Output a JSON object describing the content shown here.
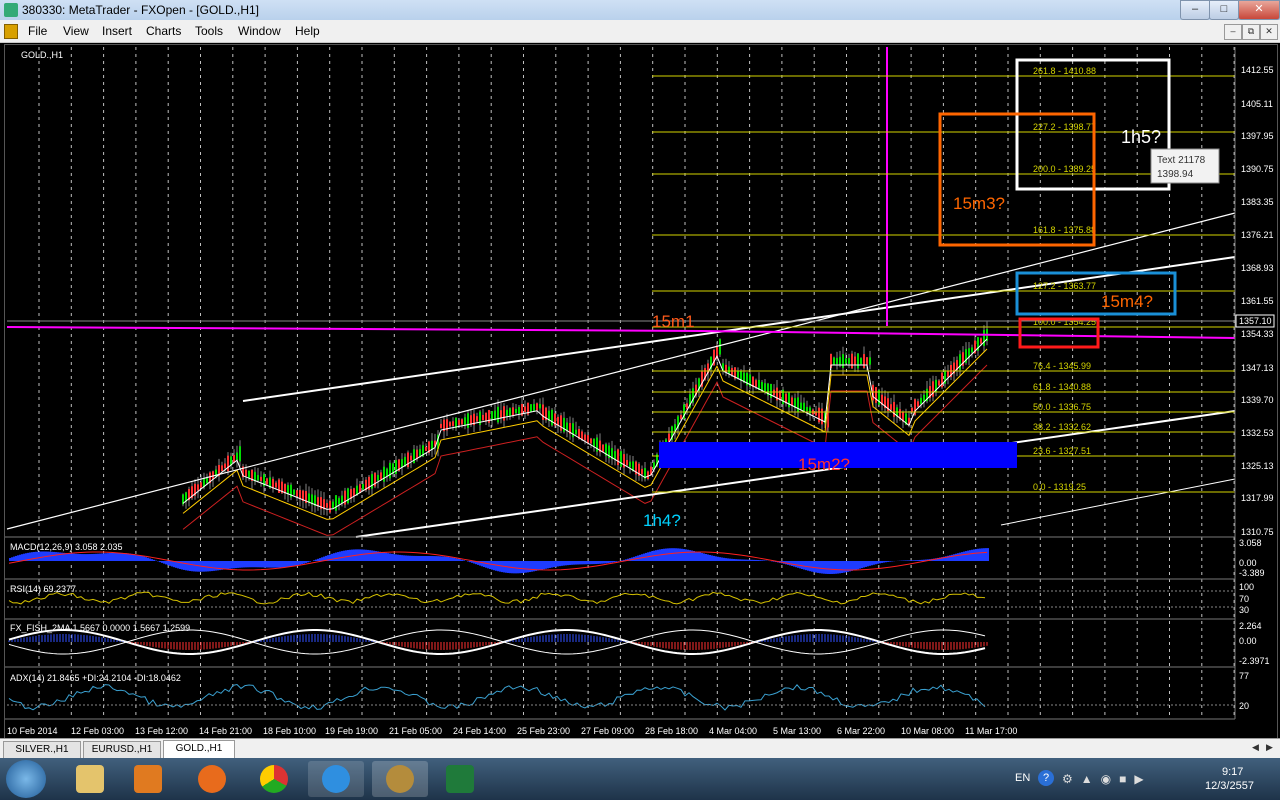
{
  "window": {
    "title": "380330: MetaTrader - FXOpen - [GOLD.,H1]"
  },
  "menu": [
    "File",
    "View",
    "Insert",
    "Charts",
    "Tools",
    "Window",
    "Help"
  ],
  "chart": {
    "symbol_label": "GOLD.,H1",
    "price_axis": [
      "1412.55",
      "1405.11",
      "1397.95",
      "1390.75",
      "1383.35",
      "1376.21",
      "1368.93",
      "1361.55",
      "1357.10",
      "1354.33",
      "1347.13",
      "1339.70",
      "1332.53",
      "1325.13",
      "1317.99",
      "1310.75"
    ],
    "current_price": "1357.10",
    "time_axis": [
      "10 Feb 2014",
      "12 Feb 03:00",
      "13 Feb 12:00",
      "14 Feb 21:00",
      "18 Feb 10:00",
      "19 Feb 19:00",
      "21 Feb 05:00",
      "24 Feb 14:00",
      "25 Feb 23:00",
      "27 Feb 09:00",
      "28 Feb 18:00",
      "4 Mar 04:00",
      "5 Mar 13:00",
      "6 Mar 22:00",
      "10 Mar 08:00",
      "11 Mar 17:00"
    ],
    "fib_levels": [
      "261.8 - 1410.88",
      "227.2 - 1398.77",
      "200.0 - 1389.25",
      "161.8 - 1375.88",
      "127.2 - 1363.77",
      "100.0 - 1354.25",
      "76.4 - 1345.99",
      "61.8 - 1340.88",
      "50.0 - 1336.75",
      "38.2 - 1332.62",
      "23.6 - 1327.51",
      "0.0 - 1319.25"
    ],
    "annotations": {
      "a15m1": "15m1",
      "a1h4": "1h4?",
      "a15m2": "15m2?",
      "a15m3": "15m3?",
      "a15m4": "15m4?",
      "a1h5": "1h5?"
    },
    "tooltip": {
      "line1": "Text 21178",
      "line2": "1398.94"
    },
    "colors": {
      "fib": "#d4d400",
      "magenta": "#ff00ff",
      "grid": "#c0c0c0",
      "white": "#ffffff",
      "orange": "#ff6600",
      "blue": "#0000ff",
      "cyan": "#00c8ff",
      "red": "#ff2020",
      "green": "#00dd00"
    }
  },
  "indicators": {
    "macd": {
      "label": "MACD(12,26,9) 3.058 2.035",
      "axis": [
        "3.058",
        "0.00",
        "-3.389"
      ]
    },
    "rsi": {
      "label": "RSI(14) 69.2377",
      "axis": [
        "100",
        "70",
        "30"
      ]
    },
    "fish": {
      "label": "FX_FISH_2MA 1.5667 0.0000 1.5667 1.2599",
      "axis": [
        "2.264",
        "0.00",
        "-2.3971"
      ]
    },
    "adx": {
      "label": "ADX(14) 21.8465 +DI:24.2104 -DI:18.0462",
      "axis": [
        "77",
        "20"
      ]
    }
  },
  "tabs": [
    "SILVER.,H1",
    "EURUSD.,H1",
    "GOLD.,H1"
  ],
  "taskbar": {
    "lang": "EN",
    "time": "9:17",
    "date": "12/3/2557"
  }
}
